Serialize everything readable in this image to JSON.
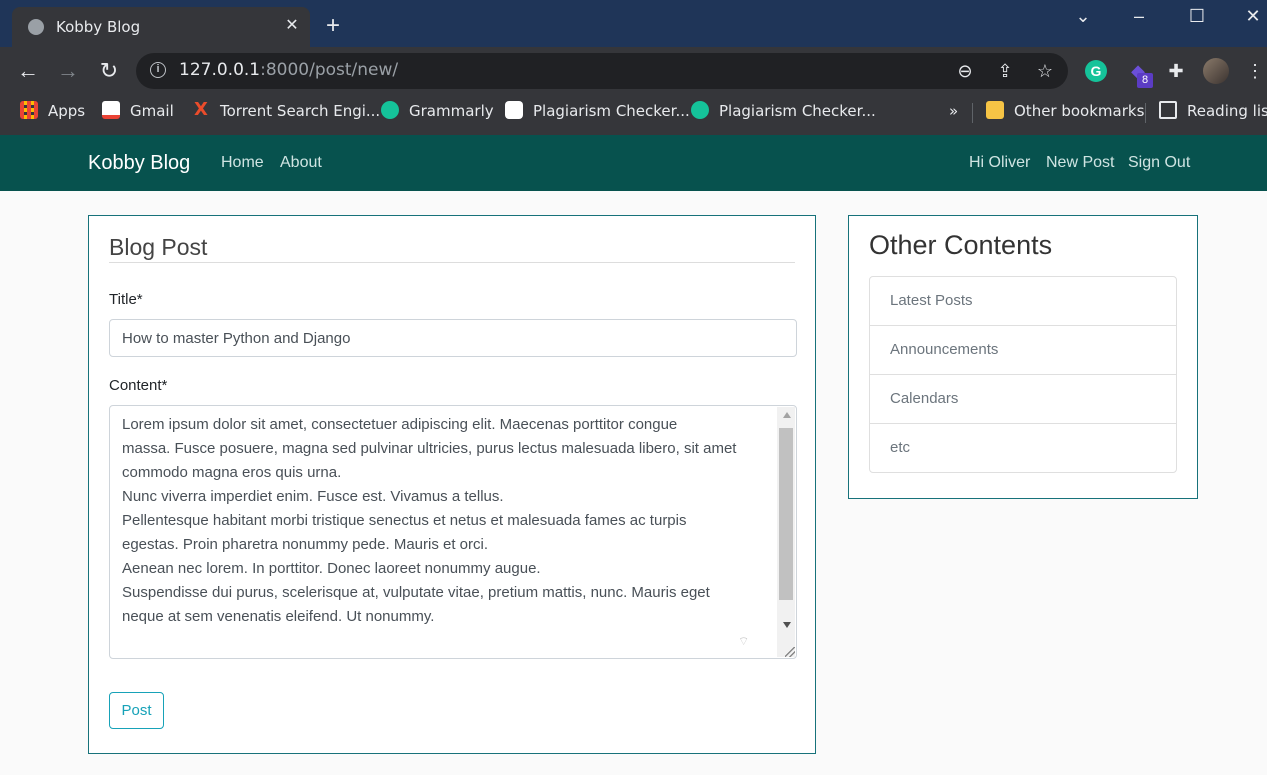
{
  "browser": {
    "tab_title": "Kobby Blog",
    "new_tab_symbol": "+",
    "url_host": "127.0.0.1",
    "url_rest": ":8000/post/new/",
    "extension_badge": "8",
    "bookmarks": [
      {
        "label": "Apps"
      },
      {
        "label": "Gmail"
      },
      {
        "label": "Torrent Search Engi..."
      },
      {
        "label": "Grammarly"
      },
      {
        "label": "Plagiarism Checker..."
      },
      {
        "label": "Plagiarism Checker..."
      }
    ],
    "overflow_label": "»",
    "other_bookmarks": "Other bookmarks",
    "reading_list": "Reading list"
  },
  "navbar": {
    "brand": "Kobby Blog",
    "links": [
      "Home",
      "About"
    ],
    "right_links": [
      "Hi Oliver",
      "New Post",
      "Sign Out"
    ]
  },
  "form": {
    "legend": "Blog Post",
    "title_label": "Title*",
    "title_value": "How to master Python and Django",
    "content_label": "Content*",
    "content_lines": [
      "Lorem ipsum dolor sit amet, consectetuer adipiscing elit. Maecenas porttitor congue",
      "massa. Fusce posuere, magna sed pulvinar ultricies, purus lectus malesuada libero, sit amet",
      "commodo magna eros quis urna.",
      "Nunc viverra imperdiet enim. Fusce est. Vivamus a tellus.",
      "Pellentesque habitant morbi tristique senectus et netus et malesuada fames ac turpis",
      "egestas. Proin pharetra nonummy pede. Mauris et orci.",
      "Aenean nec lorem. In porttitor. Donec laoreet nonummy augue.",
      "Suspendisse dui purus, scelerisque at, vulputate vitae, pretium mattis, nunc. Mauris eget",
      "neque at sem venenatis eleifend. Ut nonummy."
    ],
    "submit_label": "Post"
  },
  "sidebar": {
    "title": "Other Contents",
    "items": [
      "Latest Posts",
      "Announcements",
      "Calendars",
      "etc"
    ]
  },
  "colors": {
    "navbar_bg": "#07524e",
    "accent": "#17a2b8",
    "card_border": "#17727a"
  }
}
